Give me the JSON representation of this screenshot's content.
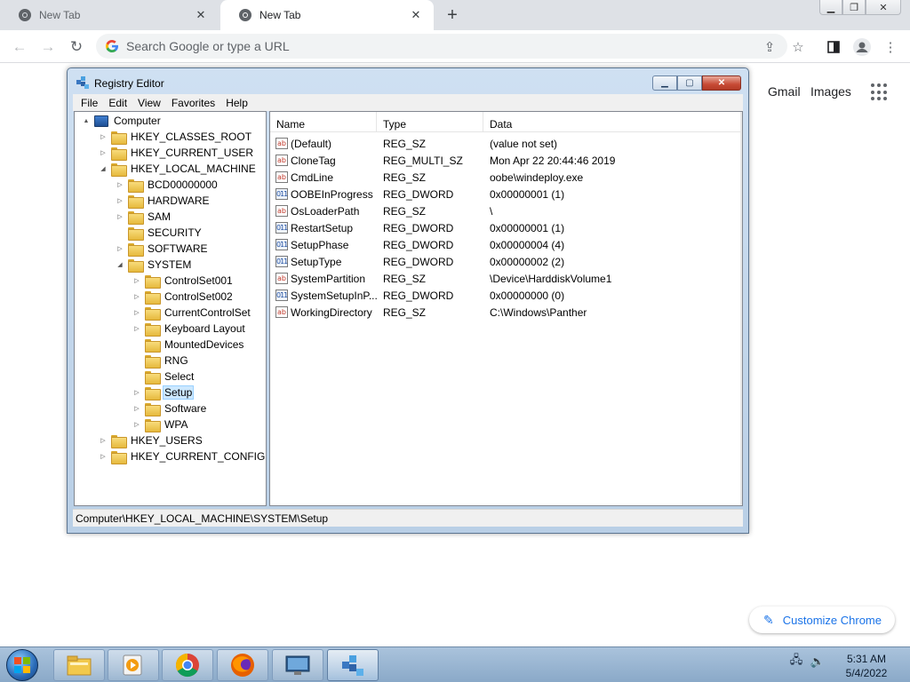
{
  "browser": {
    "tabs": [
      {
        "title": "New Tab",
        "active": false
      },
      {
        "title": "New Tab",
        "active": true
      }
    ],
    "omnibox_placeholder": "Search Google or type a URL",
    "ntp": {
      "gmail": "Gmail",
      "images": "Images",
      "customize": "Customize Chrome"
    }
  },
  "regedit": {
    "title": "Registry Editor",
    "menu": [
      "File",
      "Edit",
      "View",
      "Favorites",
      "Help"
    ],
    "status_path": "Computer\\HKEY_LOCAL_MACHINE\\SYSTEM\\Setup",
    "tree": [
      {
        "label": "Computer",
        "expander": "▲",
        "icon": "computer"
      },
      {
        "label": "HKEY_CLASSES_ROOT",
        "expander": "▷"
      },
      {
        "label": "HKEY_CURRENT_USER",
        "expander": "▷"
      },
      {
        "label": "HKEY_LOCAL_MACHINE",
        "expander": "◢"
      },
      {
        "label": "BCD00000000",
        "expander": "▷"
      },
      {
        "label": "HARDWARE",
        "expander": "▷"
      },
      {
        "label": "SAM",
        "expander": "▷"
      },
      {
        "label": "SECURITY",
        "expander": ""
      },
      {
        "label": "SOFTWARE",
        "expander": "▷"
      },
      {
        "label": "SYSTEM",
        "expander": "◢"
      },
      {
        "label": "ControlSet001",
        "expander": "▷"
      },
      {
        "label": "ControlSet002",
        "expander": "▷"
      },
      {
        "label": "CurrentControlSet",
        "expander": "▷"
      },
      {
        "label": "Keyboard Layout",
        "expander": "▷"
      },
      {
        "label": "MountedDevices",
        "expander": ""
      },
      {
        "label": "RNG",
        "expander": ""
      },
      {
        "label": "Select",
        "expander": ""
      },
      {
        "label": "Setup",
        "expander": "▷",
        "selected": true
      },
      {
        "label": "Software",
        "expander": "▷"
      },
      {
        "label": "WPA",
        "expander": "▷"
      },
      {
        "label": "HKEY_USERS",
        "expander": "▷"
      },
      {
        "label": "HKEY_CURRENT_CONFIG",
        "expander": "▷"
      }
    ],
    "columns": [
      "Name",
      "Type",
      "Data"
    ],
    "values": [
      {
        "name": "(Default)",
        "type": "REG_SZ",
        "data": "(value not set)",
        "icon": "ab"
      },
      {
        "name": "CloneTag",
        "type": "REG_MULTI_SZ",
        "data": "Mon Apr 22 20:44:46 2019",
        "icon": "ab"
      },
      {
        "name": "CmdLine",
        "type": "REG_SZ",
        "data": "oobe\\windeploy.exe",
        "icon": "ab"
      },
      {
        "name": "OOBEInProgress",
        "type": "REG_DWORD",
        "data": "0x00000001 (1)",
        "icon": "011"
      },
      {
        "name": "OsLoaderPath",
        "type": "REG_SZ",
        "data": "\\",
        "icon": "ab"
      },
      {
        "name": "RestartSetup",
        "type": "REG_DWORD",
        "data": "0x00000001 (1)",
        "icon": "011"
      },
      {
        "name": "SetupPhase",
        "type": "REG_DWORD",
        "data": "0x00000004 (4)",
        "icon": "011"
      },
      {
        "name": "SetupType",
        "type": "REG_DWORD",
        "data": "0x00000002 (2)",
        "icon": "011"
      },
      {
        "name": "SystemPartition",
        "type": "REG_SZ",
        "data": "\\Device\\HarddiskVolume1",
        "icon": "ab"
      },
      {
        "name": "SystemSetupInP...",
        "type": "REG_DWORD",
        "data": "0x00000000 (0)",
        "icon": "011"
      },
      {
        "name": "WorkingDirectory",
        "type": "REG_SZ",
        "data": "C:\\Windows\\Panther",
        "icon": "ab"
      }
    ]
  },
  "taskbar": {
    "time": "5:31 AM",
    "date": "5/4/2022"
  },
  "colors": {
    "chrome_tabstrip": "#dee1e6",
    "customize_text": "#1a73e8",
    "tree_selection": "#cce8ff"
  }
}
